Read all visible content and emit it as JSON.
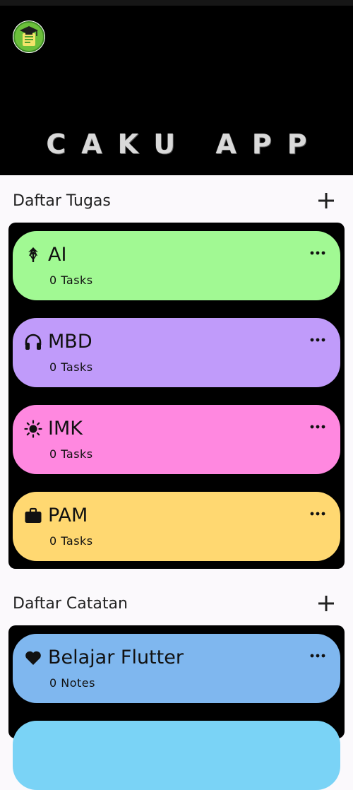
{
  "app": {
    "title": "CAKU APP"
  },
  "colors": {
    "header_bg": "#000000",
    "page_bg": "#fbf9fc",
    "ai": "#a1f993",
    "mbd": "#c09bfa",
    "imk": "#ff88e0",
    "pam": "#ffd871",
    "flutter": "#7fb7ef",
    "next": "#7ad3f6"
  },
  "tasks_section": {
    "title": "Daftar Tugas",
    "add_icon": "plus-icon",
    "items": [
      {
        "icon": "umbrella-icon",
        "title": "AI",
        "count": "0 Tasks",
        "color": "#a1f993"
      },
      {
        "icon": "headphones-icon",
        "title": "MBD",
        "count": "0 Tasks",
        "color": "#c09bfa"
      },
      {
        "icon": "sun-icon",
        "title": "IMK",
        "count": "0 Tasks",
        "color": "#ff88e0"
      },
      {
        "icon": "briefcase-icon",
        "title": "PAM",
        "count": "0 Tasks",
        "color": "#ffd871"
      }
    ]
  },
  "notes_section": {
    "title": "Daftar Catatan",
    "add_icon": "plus-icon",
    "items": [
      {
        "icon": "heart-icon",
        "title": "Belajar Flutter",
        "count": "0 Notes",
        "color": "#7fb7ef"
      }
    ]
  }
}
